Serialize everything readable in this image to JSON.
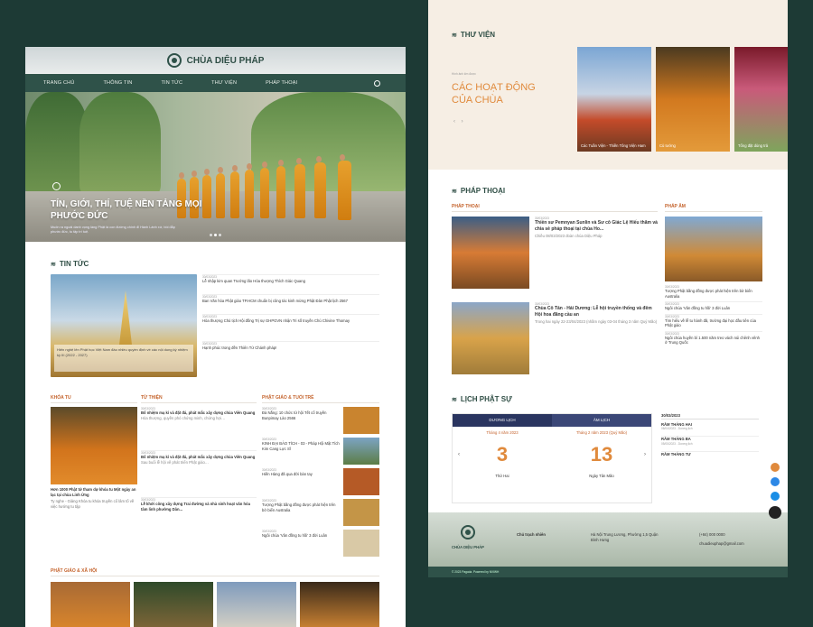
{
  "site": {
    "name": "CHÙA DIỆU PHÁP"
  },
  "nav": [
    "TRANG CHỦ",
    "THÔNG TIN",
    "TIN TỨC",
    "THƯ VIỆN",
    "PHÁP THOẠI"
  ],
  "hero": {
    "title": "TÍN, GIỚI, THÍ, TUỆ NỀN TẢNG MỌI PHƯỚC ĐỨC",
    "subtitle": "Muốn ra ngoài danh vọng làng Phật là con đường chính đi Hành Lành xứ, bồi đắp phước đức, tu tập trí tuệ."
  },
  "news": {
    "title": "TIN TỨC",
    "feature_caption": "Hiến nghệ lên Phật học Việt Nam đào nhiều quyền định về các nội dung kỳ nhiệm kỳ III (2022 - 2027)",
    "items": [
      {
        "date": "30/03/2023",
        "title": "Lễ nhập kim quan Trưởng lão Hòa thượng Thích Giác Quang"
      },
      {
        "date": "30/03/2023",
        "title": "Ban Văn hóa Phật giáo TP.HCM chuẩn bị công tác kinh mừng Phật Đản Phật lịch 2567"
      },
      {
        "date": "30/03/2023",
        "title": "Hòa thượng Chủ tịch Hội đồng Trị sự GHPGVN nhận Tri số truyền Chủ Chivine Thomay"
      },
      {
        "date": "30/03/2023",
        "title": "Hạnh phúc trong đền Thiên Tứ Chánh pháp!"
      }
    ]
  },
  "cols": [
    {
      "title": "KHÓA TU",
      "story": "Hơn 1000 Phật tử tham dự khóa tu Một ngày an lạc tại chùa Linh Ứng",
      "text": "Ty nghe - Giảng Khóa tu khóa truyền cổ lâm tổ về việc hướng tu tập"
    },
    {
      "title": "TỪ THIỆN",
      "items": [
        {
          "title": "Bổ nhiệm mạ kí và đặt đá, phát mắc xây dựng chùa Viên Quang"
        },
        {
          "title": "Bổ nhiệm mạ kí và đặt đá, phát mắc xây dựng chùa Viên Quang"
        },
        {
          "title": "Lễ khởi công xây dựng Trai đường và nhà sinh hoạt văn hóa tâm linh phường Dân..."
        }
      ]
    },
    {
      "title": "PHẬT GIÁO & TUỔI TRẺ",
      "items": [
        {
          "title": "Đà Nẵng: 10 chức từ hội Tết cổ truyền Bunpimay Lào 2566"
        },
        {
          "title": "KINH ĐẠI BẢO TÍCH - 03 - Pháp Hội Mật Tích Kim Cang Lực Sĩ"
        },
        {
          "title": "Hiền Hàng đã qua đời bàn tay"
        },
        {
          "title": "Tượng Phật bằng đồng được phát hiện trên bờ biển Australia"
        },
        {
          "title": "Ngôi chùa 'Vân đồng tu hồi' 3 đời Luân"
        }
      ]
    }
  ],
  "social": {
    "title": "PHẬT GIÁO & XÃ HỘI"
  },
  "library": {
    "title": "THƯ VIỆN",
    "kicker": "Hình ảnh lớn được",
    "heading": "CÁC HOẠT ĐỘNG CỦA CHÙA",
    "cards": [
      "Các Tuần Viện - Thiền Tông Viện Ham",
      "Cù tướng",
      "Tổng đặt dùng trả"
    ]
  },
  "talks": {
    "title": "PHÁP THOẠI",
    "tab1": "PHÁP THOẠI",
    "tab2": "PHÁP ÂM",
    "items": [
      {
        "date": "30/03/2023",
        "title": "Thiền sư Pemnyan Sunlin và Sư cô Giác Lệ Hiếu thăm và chia sẻ pháp thoại tại chùa Ho...",
        "text": "Chiều 08/03/2023 đoàn chùa Diệu Pháp"
      },
      {
        "date": "30/03/2023",
        "title": "Chùa Cô Tân - Hải Dương: Lễ hội truyền thống và đêm Hội hoa đăng cầu an",
        "text": "Trong hai ngày 22-23/04/2023 (nhằm ngày 03-04 tháng 3 năm Quý Mão)"
      }
    ],
    "audio": [
      {
        "date": "30/03/2023",
        "title": "Tượng Phật bằng đồng được phát hiện trên bờ biển Australia"
      },
      {
        "date": "30/03/2023",
        "title": "Ngôi chùa 'Vân đồng tu hồi' 3 đời Luân"
      },
      {
        "date": "30/03/2023",
        "title": "Tìm hiểu về lễ tu hành đã, trường đại học đầu tiên của Phật giáo"
      },
      {
        "date": "30/03/2023",
        "title": "Ngôi chùa huyền bí 1.500 năm treo vách núi chênh vênh ở Trung Quốc"
      }
    ]
  },
  "calendar": {
    "title": "LỊCH PHẬT SỰ",
    "solar": "DƯƠNG LỊCH",
    "lunar": "ÂM LỊCH",
    "solar_month": "Tháng 4 năm 2023",
    "lunar_month": "Tháng 2 năm 2023 (Quý Mão)",
    "solar_day": "3",
    "lunar_day": "13",
    "solar_wd": "Thứ Hai",
    "lunar_wd": "Ngày Tân Mão",
    "date_select": "30/03/2023",
    "events": [
      {
        "title": "RẰM THÁNG HAI",
        "date": "06/04/2023 - Dương lịch"
      },
      {
        "title": "RẰM THÁNG BA",
        "date": "05/05/2023 - Dương lịch"
      },
      {
        "title": "RẰM THÁNG TƯ",
        "date": ""
      }
    ]
  },
  "footer": {
    "brand": "CHÙA DIỆU PHÁP",
    "contact": "Chủ trạch nhiên",
    "address": "Hà Nội Trung Lương, Phường 1,5 Quận Bình Hưng",
    "phone": "(+84) 000 0000",
    "email": "chuadieuphap@gmail.com",
    "copyright": "© 2023 Pagoda. Powered by NVIWH"
  },
  "colors": {
    "brand": "#2f5249",
    "accent": "#c4622b",
    "calendar_head": "#2a3560",
    "bg": "#1d3a35"
  }
}
